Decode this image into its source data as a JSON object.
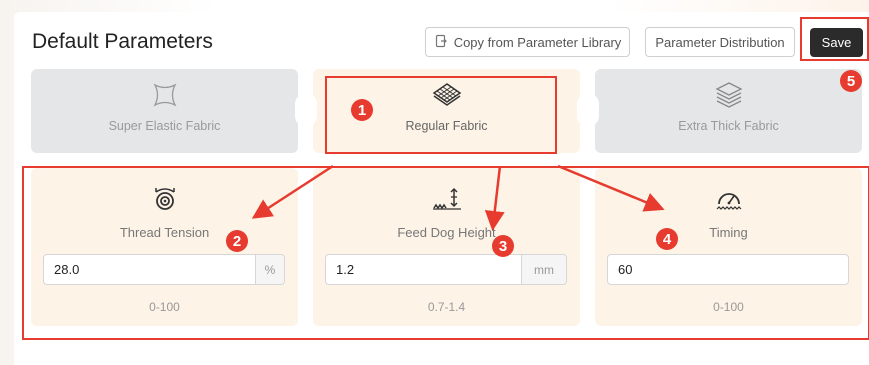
{
  "header": {
    "title": "Default Parameters",
    "copy_button": "Copy from Parameter Library",
    "distribution_button": "Parameter Distribution",
    "save_button": "Save"
  },
  "fabrics": [
    {
      "label": "Super Elastic Fabric",
      "icon": "stretch-fabric-icon"
    },
    {
      "label": "Regular Fabric",
      "icon": "regular-fabric-icon",
      "selected": true
    },
    {
      "label": "Extra Thick Fabric",
      "icon": "thick-fabric-icon"
    }
  ],
  "params": [
    {
      "label": "Thread Tension",
      "value": "28.0",
      "unit": "%",
      "range": "0-100",
      "icon": "thread-tension-icon"
    },
    {
      "label": "Feed Dog Height",
      "value": "1.2",
      "unit": "mm",
      "range": "0.7-1.4",
      "icon": "feed-dog-height-icon"
    },
    {
      "label": "Timing",
      "value": "60",
      "unit": "",
      "range": "0-100",
      "icon": "timing-gauge-icon"
    }
  ],
  "annotations": [
    "1",
    "2",
    "3",
    "4",
    "5"
  ],
  "colors": {
    "accent": "#e63b2e",
    "card_active": "#fdf3e7",
    "card_inactive": "#e4e6e8",
    "save_bg": "#2b2b2b"
  }
}
